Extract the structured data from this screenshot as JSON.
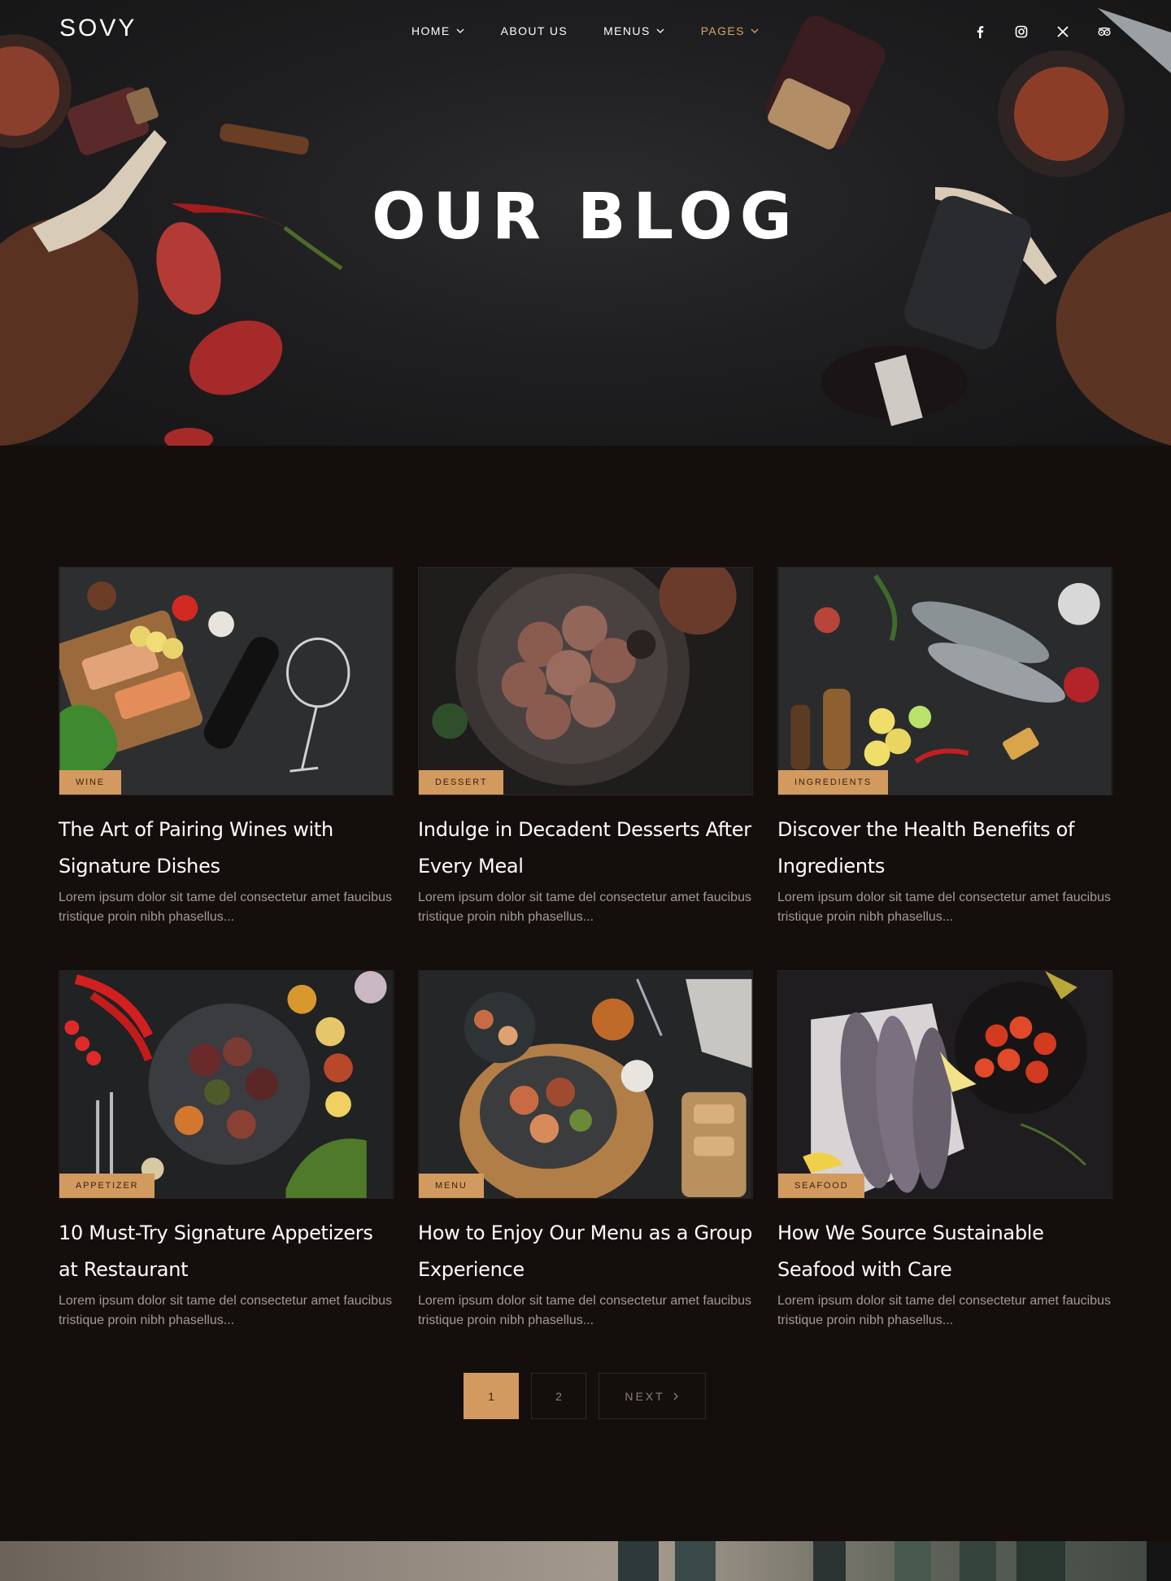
{
  "brand": {
    "name": "SOVY"
  },
  "nav": {
    "items": [
      {
        "label": "HOME",
        "has_dropdown": true,
        "active": false
      },
      {
        "label": "ABOUT US",
        "has_dropdown": false,
        "active": false
      },
      {
        "label": "MENUS",
        "has_dropdown": true,
        "active": false
      },
      {
        "label": "PAGES",
        "has_dropdown": true,
        "active": true
      }
    ]
  },
  "social": [
    "facebook-icon",
    "instagram-icon",
    "x-icon",
    "tripadvisor-icon"
  ],
  "hero": {
    "title": "OUR BLOG"
  },
  "posts": [
    {
      "tag": "WINE",
      "title": "The Art of Pairing Wines with Signature Dishes",
      "excerpt": "Lorem ipsum dolor sit tame del consectetur amet faucibus tristique proin nibh phasellus..."
    },
    {
      "tag": "DESSERT",
      "title": "Indulge in Decadent Desserts After Every Meal",
      "excerpt": "Lorem ipsum dolor sit tame del consectetur amet faucibus tristique proin nibh phasellus..."
    },
    {
      "tag": "INGREDIENTS",
      "title": "Discover the Health Benefits of Ingredients",
      "excerpt": "Lorem ipsum dolor sit tame del consectetur amet faucibus tristique proin nibh phasellus..."
    },
    {
      "tag": "APPETIZER",
      "title": "10 Must-Try Signature Appetizers at Restaurant",
      "excerpt": "Lorem ipsum dolor sit tame del consectetur amet faucibus tristique proin nibh phasellus..."
    },
    {
      "tag": "MENU",
      "title": "How to Enjoy Our Menu as a Group Experience",
      "excerpt": "Lorem ipsum dolor sit tame del consectetur amet faucibus tristique proin nibh phasellus..."
    },
    {
      "tag": "SEAFOOD",
      "title": "How We Source Sustainable Seafood with Care",
      "excerpt": "Lorem ipsum dolor sit tame del consectetur amet faucibus tristique proin nibh phasellus..."
    }
  ],
  "pagination": {
    "current": "1",
    "next_page": "2",
    "next_label": "NEXT"
  },
  "colors": {
    "accent": "#d39a5f",
    "background": "#140f0c",
    "excerpt": "#a39a93"
  }
}
